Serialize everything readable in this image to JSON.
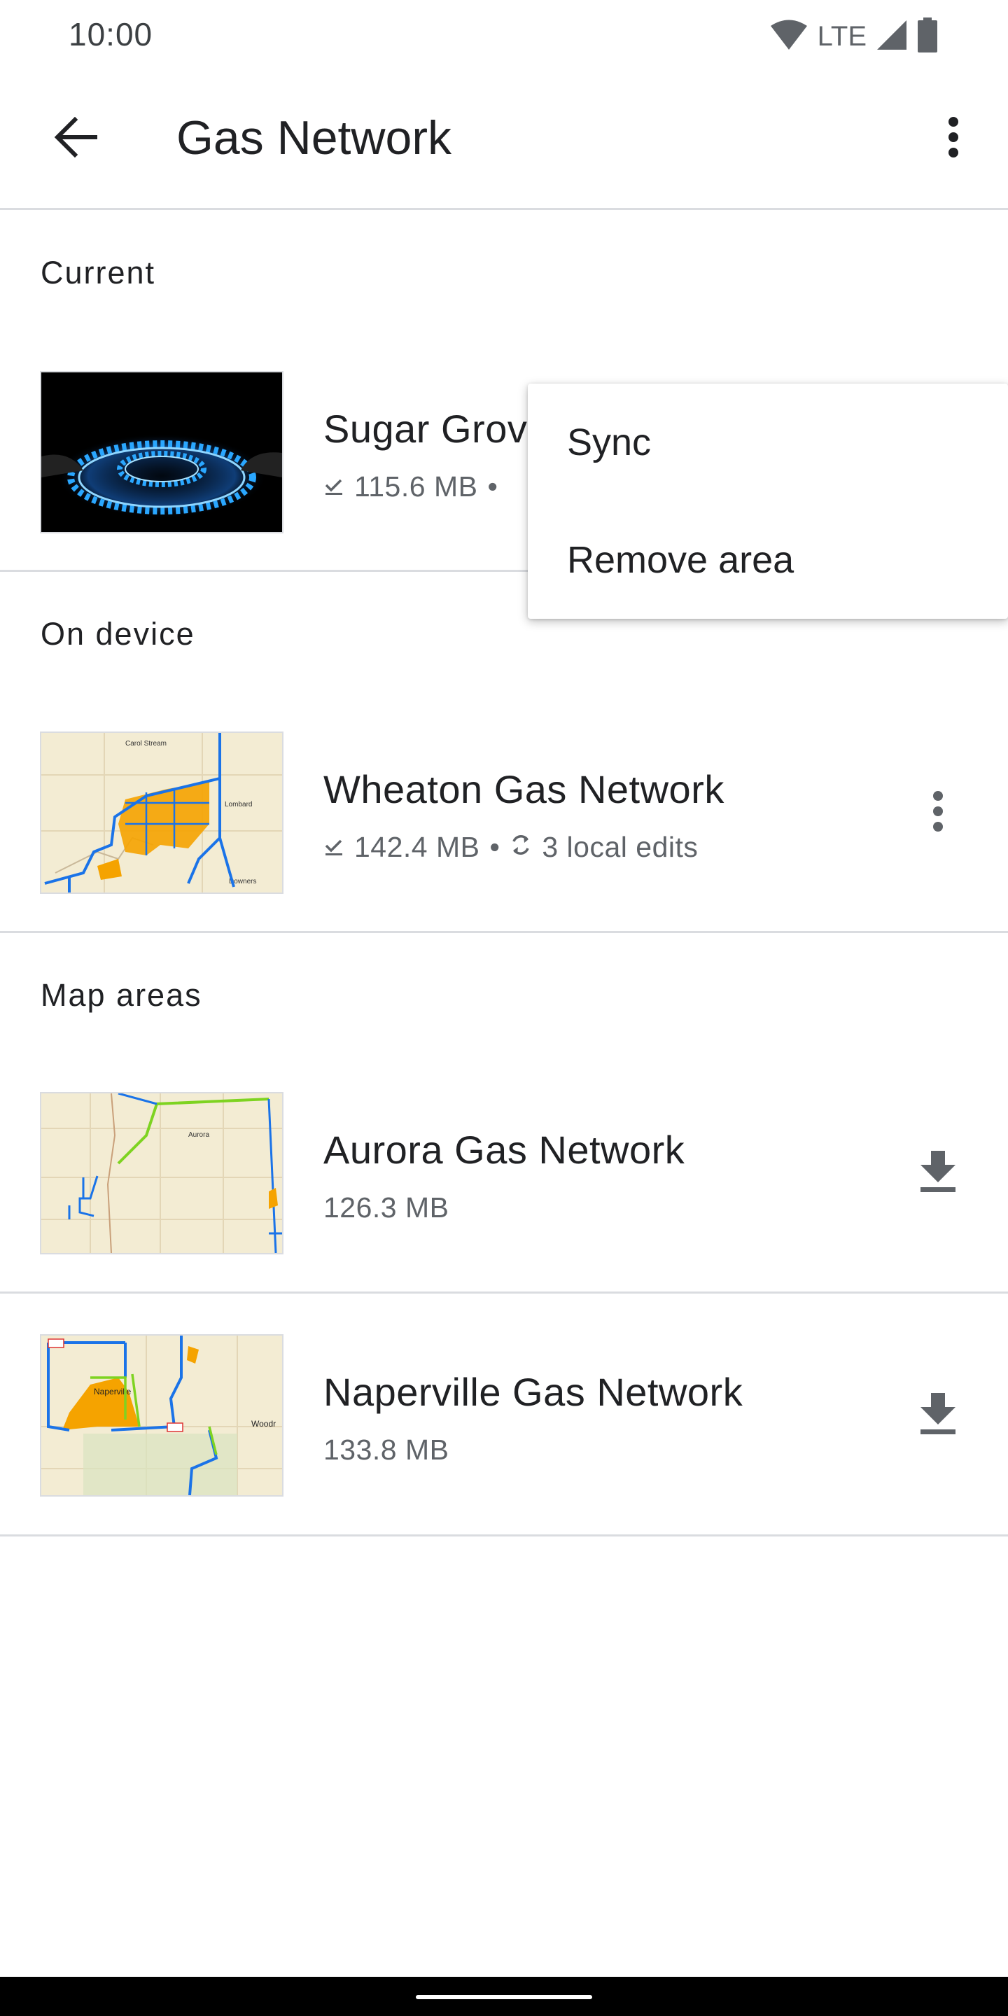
{
  "status_bar": {
    "time": "10:00",
    "network": "LTE",
    "icons": [
      "wifi-icon",
      "cell-signal-icon",
      "battery-icon"
    ]
  },
  "app_bar": {
    "title": "Gas Network",
    "back_icon": "arrow-back-icon",
    "overflow_icon": "more-vert-icon"
  },
  "sections": {
    "current": {
      "header": "Current",
      "item": {
        "title": "Sugar Grove",
        "size": "115.6 MB",
        "separator": "•",
        "thumbnail": "gas-burner-flame-image"
      }
    },
    "on_device": {
      "header": "On device",
      "item": {
        "title": "Wheaton Gas Network",
        "size": "142.4 MB",
        "separator": "•",
        "edits": "3 local edits",
        "thumbnail": "wheaton-map-thumbnail",
        "map_labels": [
          "Carol Stream",
          "Lombard",
          "Downers"
        ]
      }
    },
    "map_areas": {
      "header": "Map areas",
      "items": [
        {
          "title": "Aurora Gas Network",
          "size": "126.3 MB",
          "thumbnail": "aurora-map-thumbnail",
          "map_labels": [
            "Aurora"
          ]
        },
        {
          "title": "Naperville Gas Network",
          "size": "133.8 MB",
          "thumbnail": "naperville-map-thumbnail",
          "map_labels": [
            "Naperville",
            "Woodr"
          ]
        }
      ]
    }
  },
  "menu": {
    "items": [
      "Sync",
      "Remove area"
    ]
  },
  "colors": {
    "accent_blue": "#1a73e8",
    "flame_blue": "#2aa7ff",
    "map_orange": "#f5a300",
    "map_green": "#7ed321",
    "divider": "#dadce0",
    "secondary_text": "#5f6368"
  }
}
